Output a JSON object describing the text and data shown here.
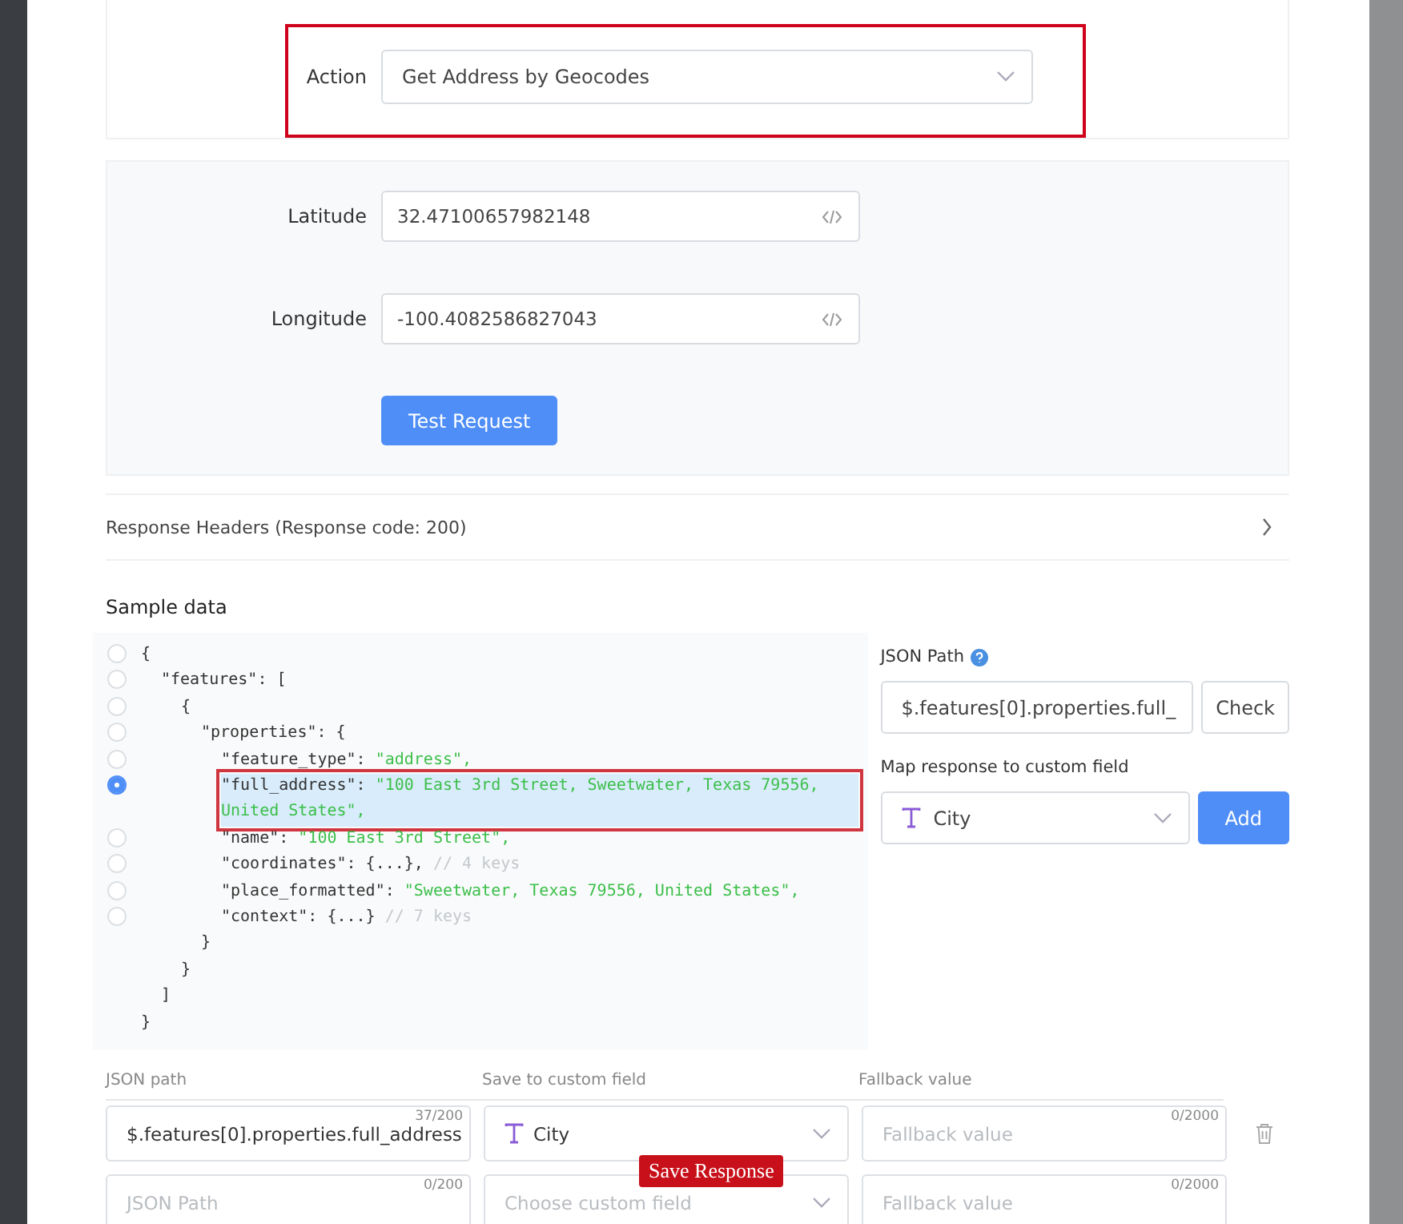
{
  "action": {
    "label": "Action",
    "value": "Get Address by Geocodes",
    "annotated": true
  },
  "params": [
    {
      "label": "Latitude",
      "value": "32.47100657982148"
    },
    {
      "label": "Longitude",
      "value": "-100.4082586827043"
    }
  ],
  "test_button": "Test Request",
  "response_headers": {
    "label": "Response Headers (Response code: 200)",
    "expanded": false
  },
  "sample": {
    "title": "Sample data",
    "lines": [
      {
        "parts": [
          {
            "text": "{",
            "kind": "plain"
          }
        ],
        "selected": false,
        "children": [
          {
            "parts": [
              {
                "text": "\"features\": [",
                "kind": "plain"
              }
            ],
            "selected": false,
            "children": [
              {
                "parts": [
                  {
                    "text": "{",
                    "kind": "plain"
                  }
                ],
                "selected": false,
                "children": [
                  {
                    "parts": [
                      {
                        "text": "\"properties\": {",
                        "kind": "plain"
                      }
                    ],
                    "selected": false,
                    "children": [
                      {
                        "parts": [
                          {
                            "text": "\"feature_type\": ",
                            "kind": "plain"
                          },
                          {
                            "text": "\"address\",",
                            "kind": "string"
                          }
                        ],
                        "selected": false
                      },
                      {
                        "parts": [
                          {
                            "text": "\"full_address\": ",
                            "kind": "plain"
                          },
                          {
                            "text": "\"100 East 3rd Street, Sweetwater, Texas 79556, United States\",",
                            "kind": "string"
                          }
                        ],
                        "selected": true,
                        "annotated": true
                      },
                      {
                        "parts": [
                          {
                            "text": "\"name\": ",
                            "kind": "plain"
                          },
                          {
                            "text": "\"100 East 3rd Street\",",
                            "kind": "string"
                          }
                        ],
                        "selected": false
                      },
                      {
                        "parts": [
                          {
                            "text": "\"coordinates\": {...}, ",
                            "kind": "plain"
                          },
                          {
                            "text": "// 4 keys",
                            "kind": "comment"
                          }
                        ],
                        "selected": false
                      },
                      {
                        "parts": [
                          {
                            "text": "\"place_formatted\": ",
                            "kind": "plain"
                          },
                          {
                            "text": "\"Sweetwater, Texas 79556, United States\",",
                            "kind": "string"
                          }
                        ],
                        "selected": false
                      },
                      {
                        "parts": [
                          {
                            "text": "\"context\": {...} ",
                            "kind": "plain"
                          },
                          {
                            "text": "// 7 keys",
                            "kind": "comment"
                          }
                        ],
                        "selected": false
                      }
                    ]
                  },
                  {
                    "parts": [
                      {
                        "text": "}",
                        "kind": "plain"
                      }
                    ]
                  }
                ]
              },
              {
                "parts": [
                  {
                    "text": "}",
                    "kind": "plain"
                  }
                ]
              }
            ]
          },
          {
            "parts": [
              {
                "text": "]",
                "kind": "plain"
              }
            ]
          }
        ]
      },
      {
        "parts": [
          {
            "text": "}",
            "kind": "plain"
          }
        ]
      }
    ]
  },
  "json_path": {
    "label": "JSON Path",
    "value": "$.features[0].properties.full_",
    "check_button": "Check"
  },
  "map": {
    "label": "Map response to custom field",
    "value": "City",
    "add_button": "Add"
  },
  "mapping_table": {
    "columns": [
      "JSON path",
      "Save to custom field",
      "Fallback value"
    ],
    "rows": [
      {
        "path": "$.features[0].properties.full_address",
        "path_count": "37/200",
        "field": "City",
        "fallback_placeholder": "Fallback value",
        "fallback_count": "0/2000",
        "deletable": true
      },
      {
        "path_placeholder": "JSON Path",
        "path_count": "0/200",
        "field_placeholder": "Choose custom field",
        "fallback_placeholder": "Fallback value",
        "fallback_count": "0/2000",
        "deletable": false
      }
    ]
  },
  "overlay_label": "Save Response"
}
